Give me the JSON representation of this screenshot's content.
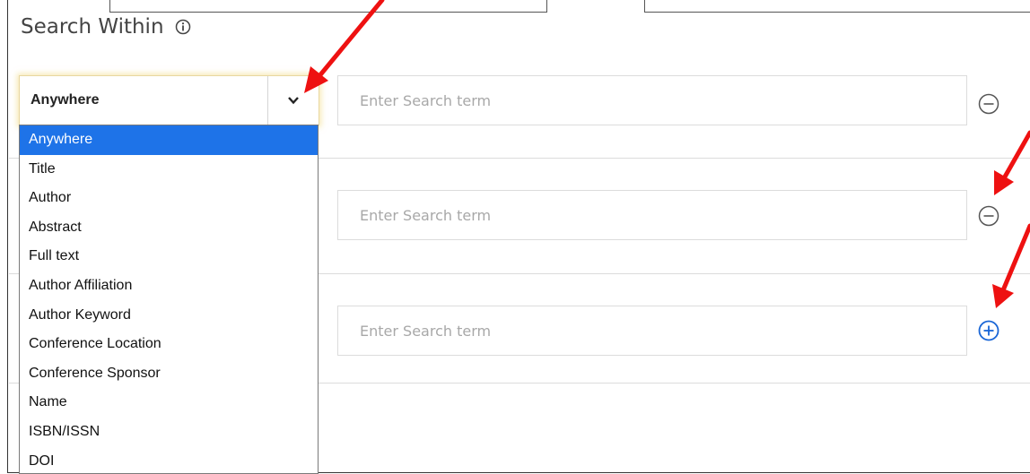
{
  "header": {
    "title": "Search Within"
  },
  "search_rows": [
    {
      "field_value": "Anywhere",
      "placeholder": "Enter Search term",
      "action": "remove"
    },
    {
      "placeholder": "Enter Search term",
      "action": "remove"
    },
    {
      "placeholder": "Enter Search term",
      "action": "add"
    }
  ],
  "dropdown": {
    "selected": "Anywhere",
    "options": [
      "Anywhere",
      "Title",
      "Author",
      "Abstract",
      "Full text",
      "Author Affiliation",
      "Author Keyword",
      "Conference Location",
      "Conference Sponsor",
      "Name",
      "ISBN/ISSN",
      "DOI"
    ]
  },
  "colors": {
    "accent": "#1e73e8",
    "annotation_arrow": "#ee1111",
    "remove_icon": "#555555",
    "add_icon": "#1a66d6"
  },
  "icons": {
    "info": "info-icon",
    "chevron": "chevron-down-icon",
    "remove": "minus-circle-icon",
    "add": "plus-circle-icon"
  }
}
